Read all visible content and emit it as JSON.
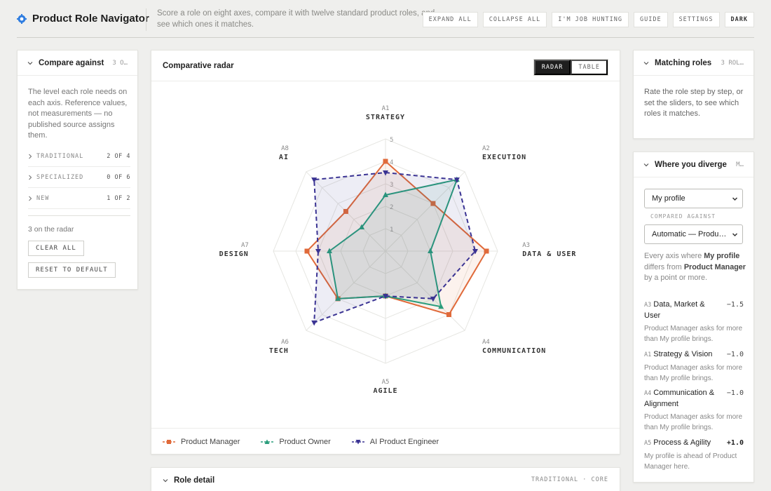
{
  "header": {
    "title": "Product Role Navigator",
    "tagline": "Score a role on eight axes, compare it with twelve standard product roles, and see which ones it matches.",
    "actions": [
      "EXPAND ALL",
      "COLLAPSE ALL",
      "I'M JOB HUNTING",
      "GUIDE",
      "SETTINGS",
      "DARK"
    ]
  },
  "compare": {
    "title": "Compare against",
    "count": "3 O…",
    "description": "The level each role needs on each axis. Reference values, not measurements — no published source assigns them.",
    "groups": [
      {
        "name": "TRADITIONAL",
        "count": "2 OF 4"
      },
      {
        "name": "SPECIALIZED",
        "count": "0 OF 6"
      },
      {
        "name": "NEW",
        "count": "1 OF 2"
      }
    ],
    "on_radar": "3 on the radar",
    "clear_label": "CLEAR ALL",
    "reset_label": "RESET TO DEFAULT"
  },
  "radar": {
    "title": "Comparative radar",
    "views": [
      "RADAR",
      "TABLE"
    ],
    "active_view": "RADAR"
  },
  "chart_data": {
    "type": "radar",
    "title": "Comparative radar",
    "axes": [
      {
        "code": "A1",
        "label": "STRATEGY"
      },
      {
        "code": "A2",
        "label": "EXECUTION"
      },
      {
        "code": "A3",
        "label": "DATA & USER"
      },
      {
        "code": "A4",
        "label": "COMMUNICATION"
      },
      {
        "code": "A5",
        "label": "AGILE"
      },
      {
        "code": "A6",
        "label": "TECH"
      },
      {
        "code": "A7",
        "label": "DESIGN"
      },
      {
        "code": "A8",
        "label": "AI"
      }
    ],
    "scale_ticks": [
      "1",
      "2",
      "3",
      "4",
      "5"
    ],
    "range": [
      0,
      5
    ],
    "series": [
      {
        "name": "Product Manager",
        "values": [
          4,
          3,
          4.5,
          4,
          2,
          3,
          3.5,
          2.5
        ],
        "color": "#e06a3a",
        "marker": "square"
      },
      {
        "name": "Product Owner",
        "values": [
          2.5,
          4.5,
          2,
          3.5,
          2,
          3,
          2.5,
          1.5
        ],
        "color": "#2a9d7c",
        "marker": "triangle"
      },
      {
        "name": "AI Product Engineer",
        "values": [
          3.5,
          4.5,
          4,
          3,
          2,
          4.5,
          3,
          4.5
        ],
        "color": "#3a3393",
        "marker": "triangle-down"
      }
    ]
  },
  "detail": {
    "title": "Role detail",
    "tag": "TRADITIONAL · CORE"
  },
  "matching": {
    "title": "Matching roles",
    "count": "3 ROL…",
    "description": "Rate the role step by step, or set the sliders, to see which roles it matches."
  },
  "diverge": {
    "title": "Where you diverge",
    "count": "M…",
    "profile_select": "My profile",
    "compared_label": "COMPARED AGAINST",
    "compare_select": "Automatic — Produ…",
    "desc_pre": "Every axis where ",
    "desc_profile": "My profile",
    "desc_mid": " differs from ",
    "desc_role": "Product Manager",
    "desc_post": " by a point or more.",
    "items": [
      {
        "code": "A3",
        "name": "Data, Market & User",
        "delta": "−1.5",
        "note": "Product Manager asks for more than My profile brings."
      },
      {
        "code": "A1",
        "name": "Strategy & Vision",
        "delta": "−1.0",
        "note": "Product Manager asks for more than My profile brings."
      },
      {
        "code": "A4",
        "name": "Communication & Alignment",
        "delta": "−1.0",
        "note": "Product Manager asks for more than My profile brings."
      },
      {
        "code": "A5",
        "name": "Process & Agility",
        "delta": "+1.0",
        "note": "My profile is ahead of Product Manager here."
      }
    ]
  }
}
